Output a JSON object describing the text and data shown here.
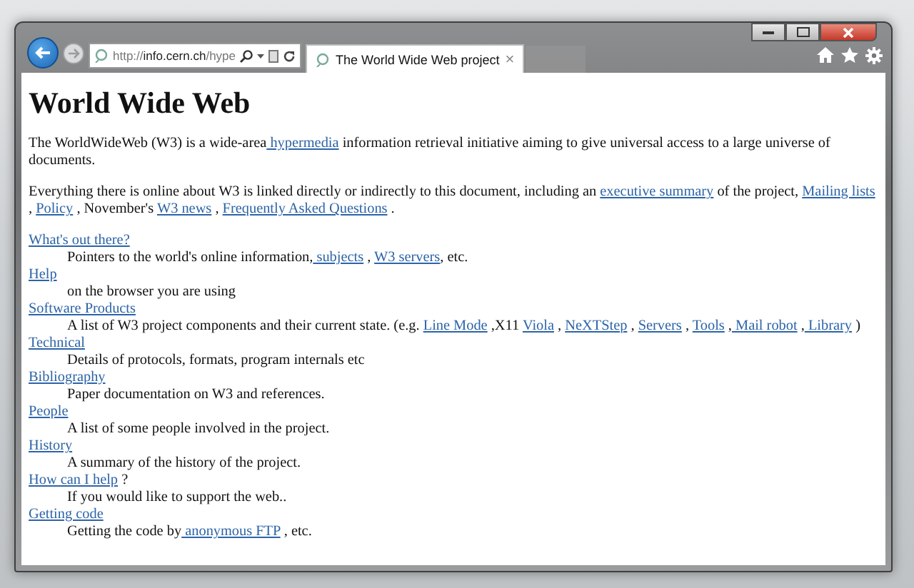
{
  "address_bar": {
    "url": "http://**info.cern.ch**/hype"
  },
  "tabs": [
    {
      "title": "The World Wide Web project",
      "close": "×",
      "selected": true
    }
  ],
  "page": {
    "heading": "World Wide Web",
    "paragraphs": [
      [
        {
          "kind": "text",
          "text": "The WorldWideWeb (W3) is a wide-area"
        },
        {
          "kind": "link",
          "text": " hypermedia"
        },
        {
          "kind": "text",
          "text": " information retrieval initiative aiming to give universal access to a large universe of documents."
        }
      ],
      [
        {
          "kind": "text",
          "text": "Everything there is online about W3 is linked directly or indirectly to this document, including an "
        },
        {
          "kind": "link",
          "text": "executive summary"
        },
        {
          "kind": "text",
          "text": " of the project, "
        },
        {
          "kind": "link",
          "text": "Mailing lists"
        },
        {
          "kind": "text",
          "text": " , "
        },
        {
          "kind": "link",
          "text": "Policy"
        },
        {
          "kind": "text",
          "text": " , November's "
        },
        {
          "kind": "link",
          "text": "W3 news"
        },
        {
          "kind": "text",
          "text": " , "
        },
        {
          "kind": "link",
          "text": "Frequently Asked Questions"
        },
        {
          "kind": "text",
          "text": " ."
        }
      ]
    ],
    "entries": [
      {
        "term": [
          {
            "kind": "link",
            "text": "What's out there?"
          }
        ],
        "description": [
          {
            "kind": "text",
            "text": "Pointers to the world's online information,"
          },
          {
            "kind": "link",
            "text": " subjects"
          },
          {
            "kind": "text",
            "text": " , "
          },
          {
            "kind": "link",
            "text": "W3 servers"
          },
          {
            "kind": "text",
            "text": ", etc."
          }
        ]
      },
      {
        "term": [
          {
            "kind": "link",
            "text": "Help"
          }
        ],
        "description": [
          {
            "kind": "text",
            "text": "on the browser you are using"
          }
        ]
      },
      {
        "term": [
          {
            "kind": "link",
            "text": "Software Products"
          }
        ],
        "description": [
          {
            "kind": "text",
            "text": "A list of W3 project components and their current state. (e.g. "
          },
          {
            "kind": "link",
            "text": "Line Mode"
          },
          {
            "kind": "text",
            "text": " ,X11 "
          },
          {
            "kind": "link",
            "text": "Viola"
          },
          {
            "kind": "text",
            "text": " , "
          },
          {
            "kind": "link",
            "text": "NeXTStep"
          },
          {
            "kind": "text",
            "text": " , "
          },
          {
            "kind": "link",
            "text": "Servers"
          },
          {
            "kind": "text",
            "text": " , "
          },
          {
            "kind": "link",
            "text": "Tools"
          },
          {
            "kind": "text",
            "text": " ,"
          },
          {
            "kind": "link",
            "text": " Mail robot"
          },
          {
            "kind": "text",
            "text": " ,"
          },
          {
            "kind": "link",
            "text": " Library"
          },
          {
            "kind": "text",
            "text": " )"
          }
        ]
      },
      {
        "term": [
          {
            "kind": "link",
            "text": "Technical"
          }
        ],
        "description": [
          {
            "kind": "text",
            "text": "Details of protocols, formats, program internals etc"
          }
        ]
      },
      {
        "term": [
          {
            "kind": "link",
            "text": "Bibliography"
          }
        ],
        "description": [
          {
            "kind": "text",
            "text": "Paper documentation on W3 and references."
          }
        ]
      },
      {
        "term": [
          {
            "kind": "link",
            "text": "People"
          }
        ],
        "description": [
          {
            "kind": "text",
            "text": "A list of some people involved in the project."
          }
        ]
      },
      {
        "term": [
          {
            "kind": "link",
            "text": "History"
          }
        ],
        "description": [
          {
            "kind": "text",
            "text": "A summary of the history of the project."
          }
        ]
      },
      {
        "term": [
          {
            "kind": "link",
            "text": "How can I help"
          },
          {
            "kind": "text",
            "text": " ?"
          }
        ],
        "description": [
          {
            "kind": "text",
            "text": "If you would like to support the web.."
          }
        ]
      },
      {
        "term": [
          {
            "kind": "link",
            "text": "Getting code"
          }
        ],
        "description": [
          {
            "kind": "text",
            "text": "Getting the code by"
          },
          {
            "kind": "link",
            "text": " anonymous FTP"
          },
          {
            "kind": "text",
            "text": " , etc."
          }
        ]
      }
    ]
  }
}
